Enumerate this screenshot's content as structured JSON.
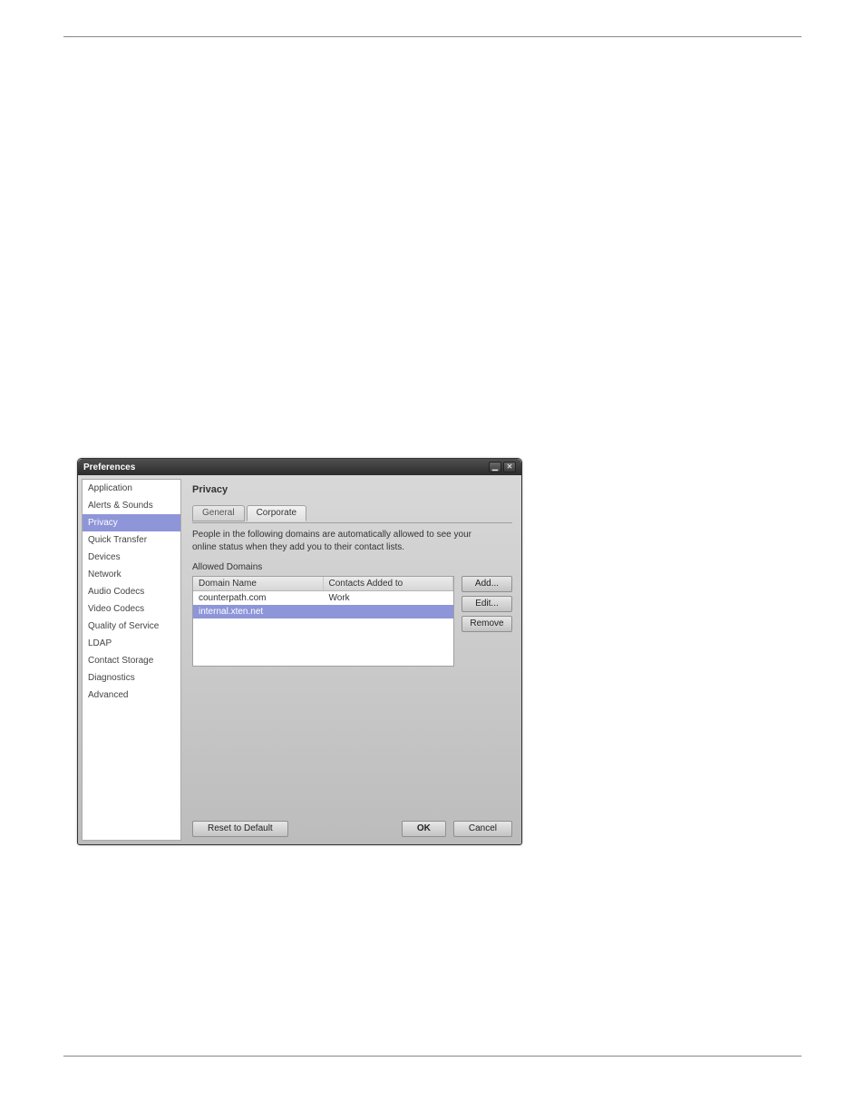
{
  "window": {
    "title": "Preferences",
    "sidebar": {
      "items": [
        {
          "label": "Application"
        },
        {
          "label": "Alerts & Sounds"
        },
        {
          "label": "Privacy",
          "selected": true
        },
        {
          "label": "Quick Transfer"
        },
        {
          "label": "Devices"
        },
        {
          "label": "Network"
        },
        {
          "label": "Audio Codecs"
        },
        {
          "label": "Video Codecs"
        },
        {
          "label": "Quality of Service"
        },
        {
          "label": "LDAP"
        },
        {
          "label": "Contact Storage"
        },
        {
          "label": "Diagnostics"
        },
        {
          "label": "Advanced"
        }
      ]
    },
    "panel": {
      "title": "Privacy",
      "tabs": [
        {
          "label": "General"
        },
        {
          "label": "Corporate",
          "active": true
        }
      ],
      "description": "People in the following domains are automatically allowed to see your online status when they add you to their contact lists.",
      "section_label": "Allowed Domains",
      "table": {
        "headers": {
          "domain": "Domain Name",
          "added": "Contacts Added to"
        },
        "rows": [
          {
            "domain": "counterpath.com",
            "added": "Work"
          },
          {
            "domain": "internal.xten.net",
            "added": "",
            "selected": true
          }
        ]
      },
      "buttons": {
        "add": "Add...",
        "edit": "Edit...",
        "remove": "Remove"
      },
      "footer": {
        "reset": "Reset to Default",
        "ok": "OK",
        "cancel": "Cancel"
      }
    }
  }
}
